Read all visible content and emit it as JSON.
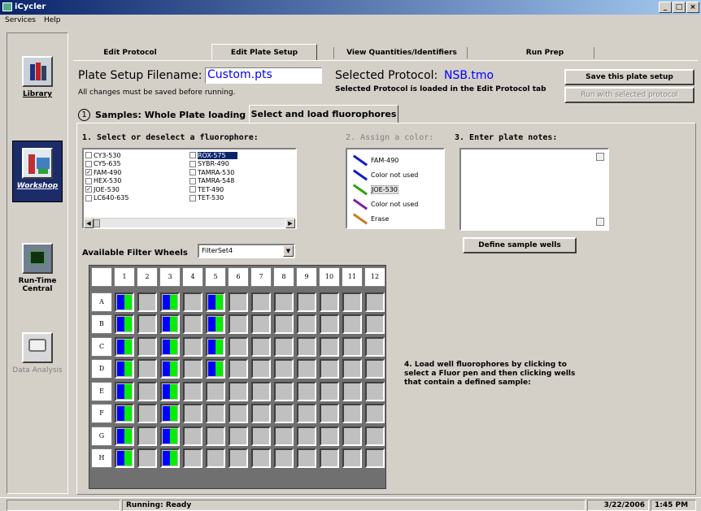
{
  "window": {
    "title": "iCycler",
    "buttons": [
      "_",
      "□",
      "×"
    ]
  },
  "menu": [
    "Services",
    "Help"
  ],
  "nav": [
    {
      "label": "Library",
      "icon": "books-icon"
    },
    {
      "label": "Workshop",
      "icon": "workshop-icon"
    },
    {
      "label": "Run-Time Central",
      "icon": "monitor-icon"
    },
    {
      "label": "Data Analysis",
      "icon": "analysis-icon"
    }
  ],
  "tabs": [
    "Edit Protocol",
    "Edit Plate Setup",
    "View Quantities/Identifiers",
    "Run Prep"
  ],
  "plate_setup": {
    "filename_label": "Plate Setup Filename:",
    "filename_value": "Custom.pts",
    "save_note": "All changes must be saved before running.",
    "protocol_label": "Selected Protocol:",
    "protocol_value": "NSB.tmo",
    "protocol_note": "Selected Protocol is loaded in the Edit Protocol tab",
    "save_button": "Save this plate setup",
    "run_button": "Run with selected protocol"
  },
  "subtabs": {
    "samples_num": "1",
    "samples": "Samples: Whole Plate loading",
    "fluor": "Select and load fluorophores"
  },
  "section1": {
    "title": "1. Select or deselect a fluorophore:",
    "fluorophores_col1": [
      {
        "name": "CY3-530",
        "checked": false
      },
      {
        "name": "CY5-635",
        "checked": false
      },
      {
        "name": "FAM-490",
        "checked": true
      },
      {
        "name": "HEX-530",
        "checked": false
      },
      {
        "name": "JOE-530",
        "checked": true
      },
      {
        "name": "LC640-635",
        "checked": false
      }
    ],
    "fluorophores_col2": [
      {
        "name": "ROX-575",
        "checked": false,
        "selected": true
      },
      {
        "name": "SYBR-490",
        "checked": false
      },
      {
        "name": "TAMRA-530",
        "checked": false
      },
      {
        "name": "TAMRA-548",
        "checked": false
      },
      {
        "name": "TET-490",
        "checked": false
      },
      {
        "name": "TET-530",
        "checked": false
      }
    ]
  },
  "section2": {
    "title": "2. Assign a color:",
    "colors": [
      {
        "label": "FAM-490",
        "color": "#1020c0"
      },
      {
        "label": "Color not used",
        "color": "#1020c0"
      },
      {
        "label": "JOE-530",
        "color": "#30a010"
      },
      {
        "label": "Color not used",
        "color": "#8020a0"
      },
      {
        "label": "Erase",
        "color": "#c08020"
      }
    ]
  },
  "section3": {
    "title": "3. Enter plate notes:",
    "define_button": "Define sample wells"
  },
  "filter": {
    "label": "Available Filter Wheels",
    "value": "FilterSet4"
  },
  "plate": {
    "cols": [
      "1",
      "2",
      "3",
      "4",
      "5",
      "6",
      "7",
      "8",
      "9",
      "10",
      "11",
      "12"
    ],
    "rows": [
      "A",
      "B",
      "C",
      "D",
      "E",
      "F",
      "G",
      "H"
    ],
    "loaded_wells": {
      "1": "blue-green",
      "3": "blue-green",
      "5": "blue-green"
    },
    "loaded_rows_col5": [
      "A",
      "B",
      "C",
      "D"
    ]
  },
  "instructions": "4. Load well fluorophores by clicking to select a Fluor pen and then clicking wells that contain a defined sample:",
  "status": {
    "text": "Running: Ready",
    "date": "3/22/2006",
    "time": "1:45 PM"
  }
}
